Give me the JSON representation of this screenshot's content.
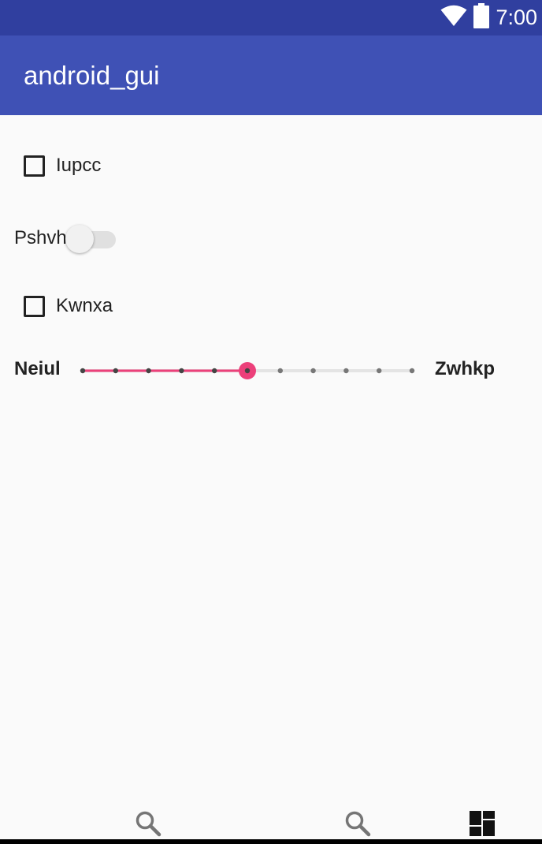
{
  "status_bar": {
    "time": "7:00",
    "icons": [
      "wifi-icon",
      "battery-icon"
    ],
    "color": "#303f9f"
  },
  "app_bar": {
    "title": "android_gui",
    "color": "#3f51b5"
  },
  "controls": {
    "checkbox_1": {
      "label": "Iupcc",
      "checked": false
    },
    "switch_1": {
      "label": "Pshvh",
      "on": false
    },
    "checkbox_2": {
      "label": "Kwnxa",
      "checked": false
    },
    "slider_1": {
      "min_label": "Neiul",
      "max_label": "Zwhkp",
      "steps": 10,
      "value_step": 5,
      "accent_color": "#ec407a"
    }
  },
  "bottom_nav": {
    "items": [
      {
        "icon": "search-icon"
      },
      {
        "icon": "search-icon"
      },
      {
        "icon": "dashboard-icon"
      }
    ]
  }
}
